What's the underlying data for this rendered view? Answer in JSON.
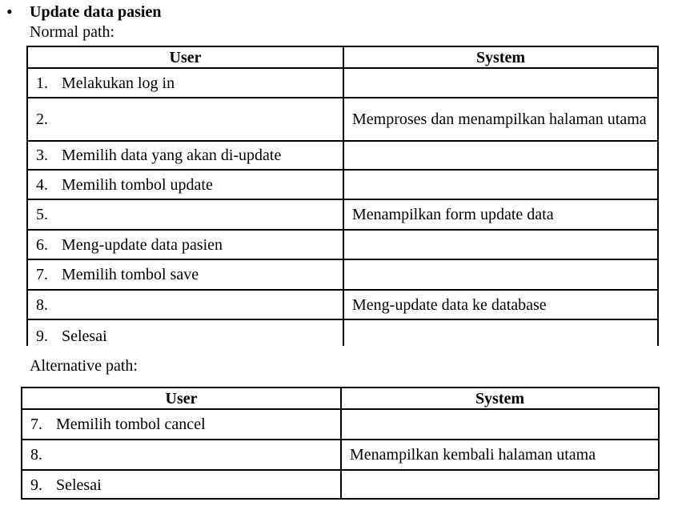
{
  "heading": {
    "bullet": "•",
    "title": "Update data pasien"
  },
  "normal_path": {
    "label": "Normal path:",
    "headers": [
      "User",
      "System"
    ],
    "rows": [
      {
        "num": "1.",
        "user": "Melakukan log in",
        "system": ""
      },
      {
        "num": "2.",
        "user": "",
        "system": "Memproses dan menampilkan halaman utama"
      },
      {
        "num": "3.",
        "user": "Memilih data yang akan di-update",
        "system": ""
      },
      {
        "num": "4.",
        "user": "Memilih tombol update",
        "system": ""
      },
      {
        "num": "5.",
        "user": "",
        "system": "Menampilkan form update data"
      },
      {
        "num": "6.",
        "user": "Meng-update data pasien",
        "system": ""
      },
      {
        "num": "7.",
        "user": "Memilih tombol save",
        "system": ""
      },
      {
        "num": "8.",
        "user": "",
        "system": "Meng-update data ke database"
      },
      {
        "num": "9.",
        "user": "Selesai",
        "system": ""
      }
    ]
  },
  "alternative_path": {
    "label": "Alternative path:",
    "headers": [
      "User",
      "System"
    ],
    "rows": [
      {
        "num": "7.",
        "user": "Memilih tombol cancel",
        "system": ""
      },
      {
        "num": "8.",
        "user": "",
        "system": "Menampilkan kembali halaman utama"
      },
      {
        "num": "9.",
        "user": "Selesai",
        "system": ""
      }
    ]
  }
}
